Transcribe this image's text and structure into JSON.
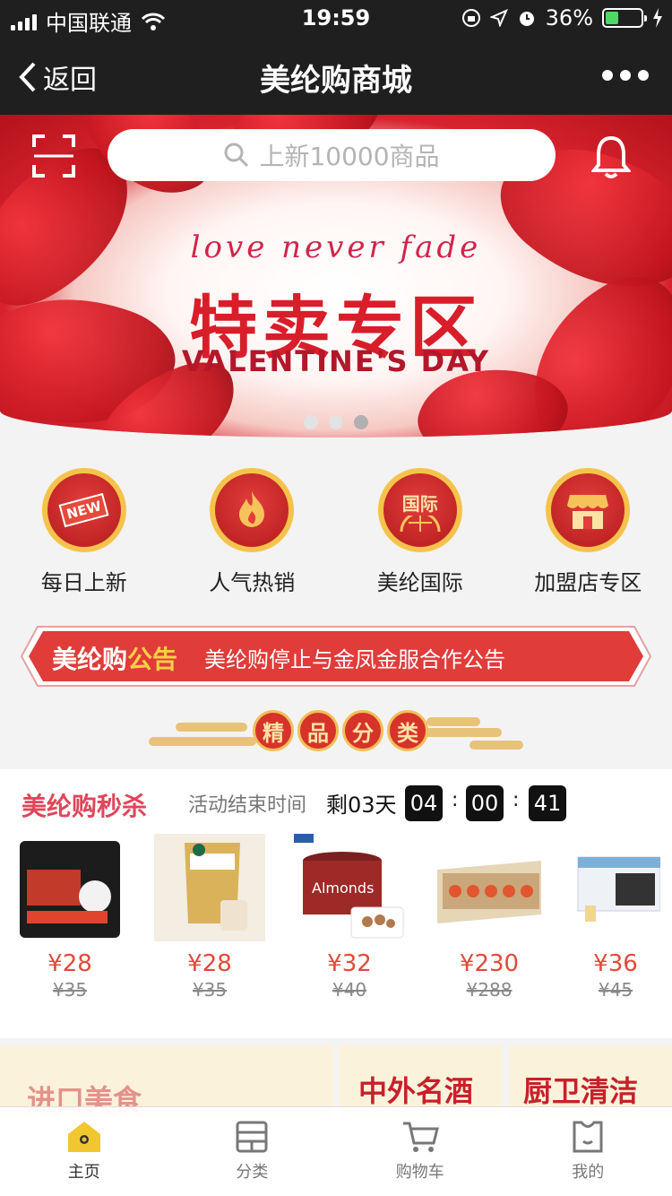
{
  "status_bar": {
    "carrier": "中国联通",
    "time": "19:59",
    "battery": "36%"
  },
  "nav": {
    "back_label": "返回",
    "title": "美纶购商城"
  },
  "banner": {
    "search_placeholder": "上新10000商品",
    "script_text": "love never fade",
    "title": "特卖专区",
    "subtitle": "VALENTINE'S DAY",
    "slide_count": 3,
    "active_slide": 3
  },
  "quick_nav": [
    {
      "label": "每日上新",
      "icon": "new-icon",
      "badge": "NEW"
    },
    {
      "label": "人气热销",
      "icon": "fire-icon"
    },
    {
      "label": "美纶国际",
      "icon": "globe-icon",
      "badge": "国际"
    },
    {
      "label": "加盟店专区",
      "icon": "store-icon"
    }
  ],
  "notice": {
    "brand": "美纶购",
    "brand_highlight": "公告",
    "message": "美纶购停止与金凤金服合作公告"
  },
  "section_header": {
    "chars": [
      "精",
      "品",
      "分",
      "类"
    ]
  },
  "flash_sale": {
    "title": "美纶购秒杀",
    "end_label": "活动结束时间",
    "remaining": "剩03天",
    "hours": "04",
    "minutes": "00",
    "seconds": "41",
    "products": [
      {
        "price": "¥28",
        "old_price": "¥35"
      },
      {
        "price": "¥28",
        "old_price": "¥35"
      },
      {
        "price": "¥32",
        "old_price": "¥40"
      },
      {
        "price": "¥230",
        "old_price": "¥288"
      },
      {
        "price": "¥36",
        "old_price": "¥45"
      }
    ]
  },
  "tiles": {
    "left": "进口美食",
    "middle": "中外名酒",
    "right": "厨卫清洁"
  },
  "tab_bar": [
    {
      "label": "主页",
      "icon": "home-icon",
      "active": true
    },
    {
      "label": "分类",
      "icon": "category-icon"
    },
    {
      "label": "购物车",
      "icon": "cart-icon"
    },
    {
      "label": "我的",
      "icon": "profile-icon"
    }
  ]
}
